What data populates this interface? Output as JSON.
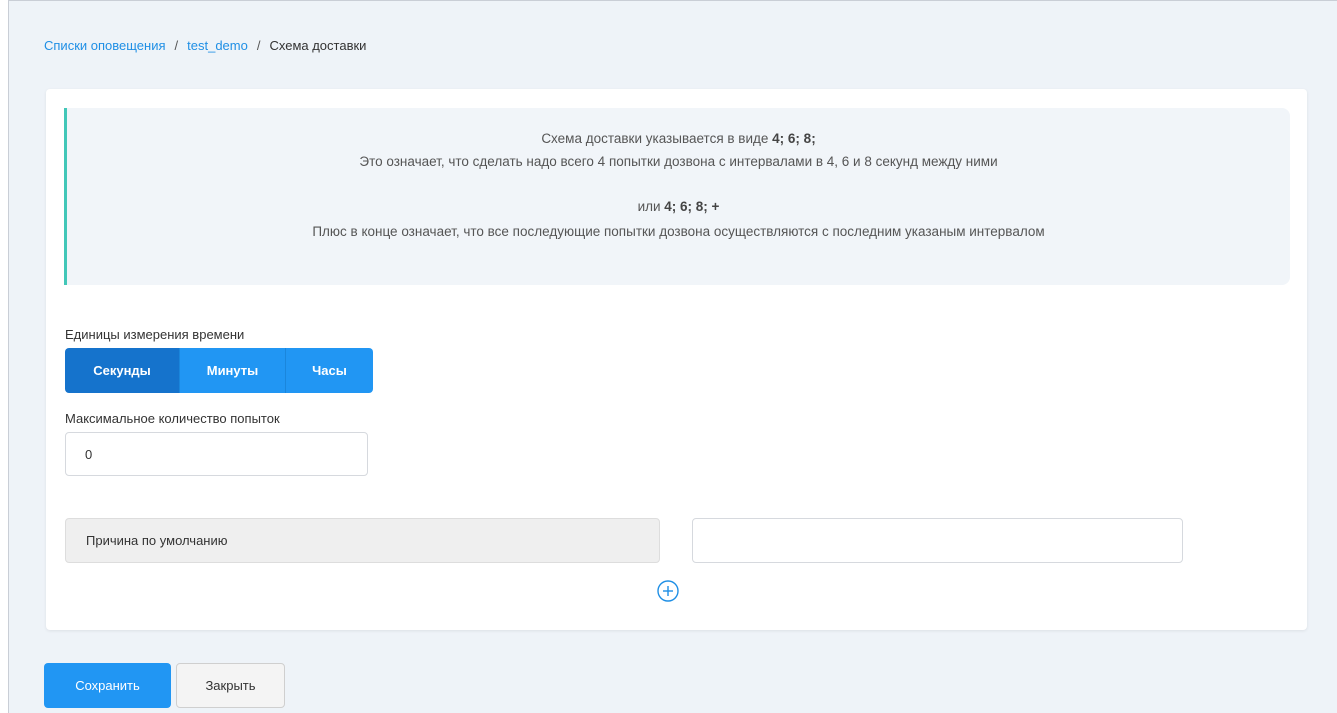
{
  "breadcrumb": {
    "items": [
      {
        "label": "Списки оповещения"
      },
      {
        "label": "test_demo"
      }
    ],
    "separator": "/",
    "current": "Схема доставки"
  },
  "info": {
    "line1_text": "Схема доставки указывается в виде ",
    "line1_bold": "4; 6; 8;",
    "line2": "Это означает, что сделать надо всего 4 попытки дозвона с интервалами в 4, 6 и 8 секунд между ними",
    "line3_text": "или ",
    "line3_bold": "4; 6; 8; +",
    "line4": "Плюс в конце означает, что все последующие попытки дозвона осуществляются с последним указаным интервалом"
  },
  "time_units": {
    "label": "Единицы измерения времени",
    "options": [
      "Секунды",
      "Минуты",
      "Часы"
    ],
    "selected": "Секунды"
  },
  "max_attempts": {
    "label": "Максимальное количество попыток",
    "value": "0"
  },
  "reasons": {
    "default_label": "Причина по умолчанию",
    "input_value": ""
  },
  "actions": {
    "save_label": "Сохранить",
    "close_label": "Закрыть"
  },
  "colors": {
    "accent": "#2196f3",
    "accent_active": "#1573cc",
    "info_border": "#42c7b8",
    "link": "#1f8fe5"
  },
  "icons": {
    "add": "plus-circle-icon"
  }
}
